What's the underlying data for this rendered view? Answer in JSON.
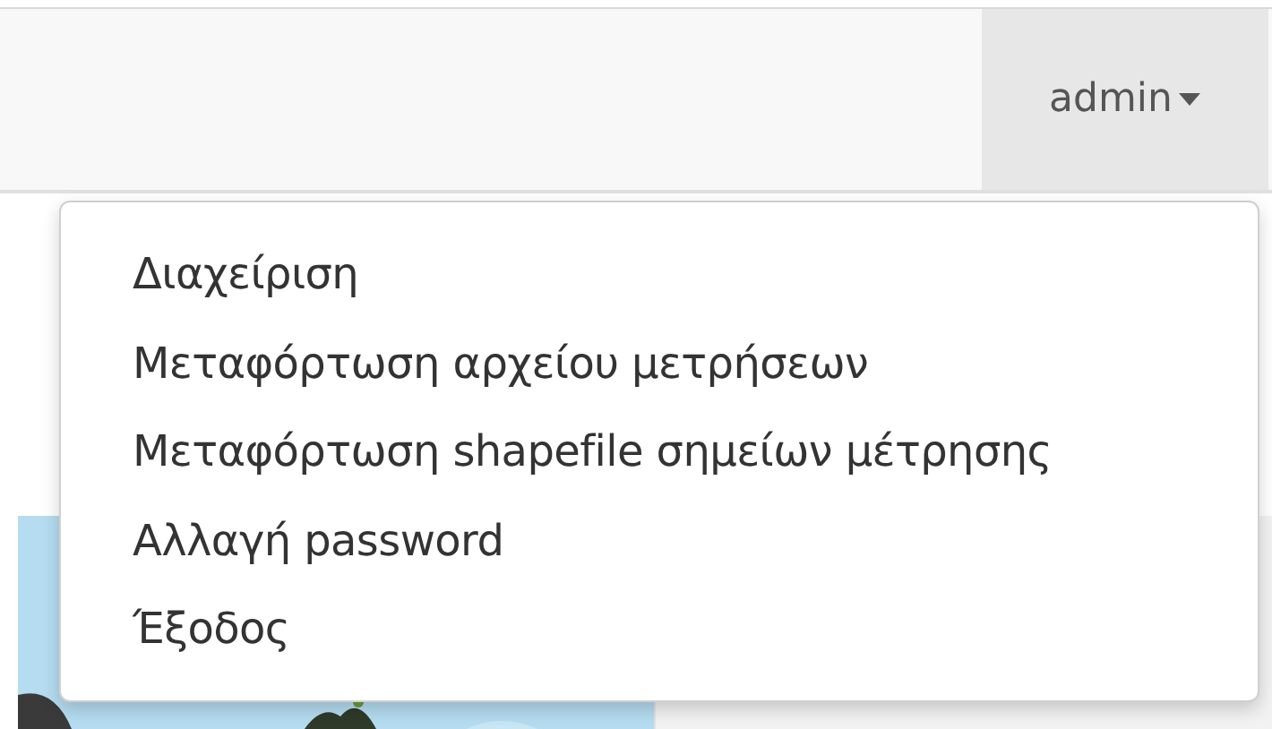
{
  "navbar": {
    "user_menu": {
      "label": "admin",
      "expanded": true
    }
  },
  "dropdown": {
    "items": [
      {
        "label": "Διαχείριση"
      },
      {
        "label": "Μεταφόρτωση αρχείου μετρήσεων"
      },
      {
        "label": "Μεταφόρτωση shapefile σημείων μέτρησης"
      },
      {
        "label": "Αλλαγή password"
      },
      {
        "label": "Έξοδος"
      }
    ]
  }
}
